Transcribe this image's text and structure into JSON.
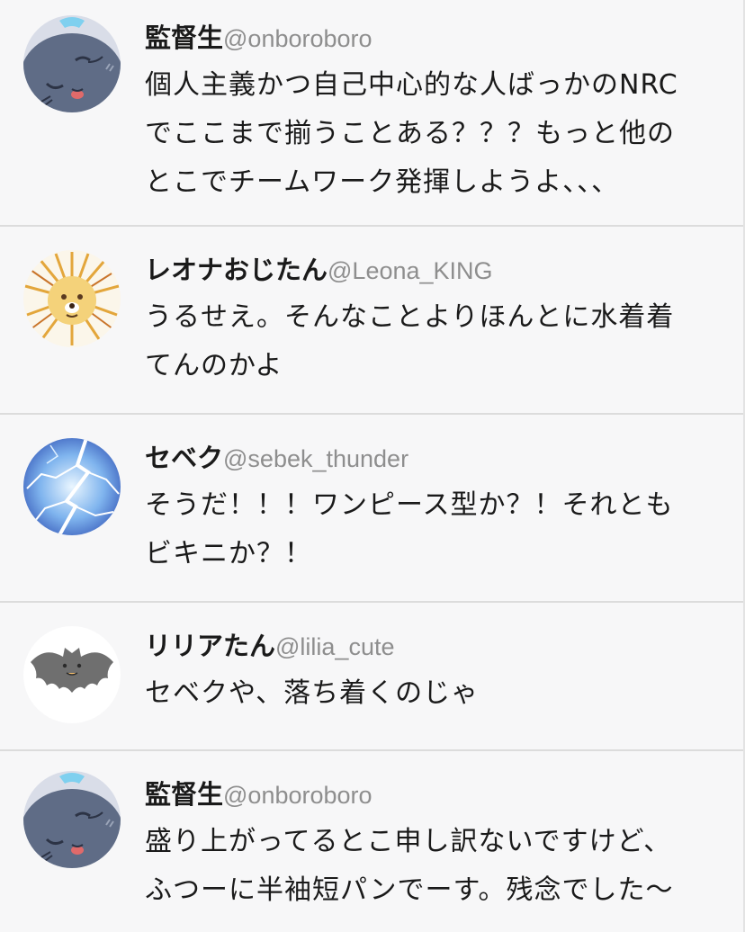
{
  "posts": [
    {
      "name": "監督生",
      "handle": "@onboroboro",
      "avatar": "gray-cat-avatar",
      "lines": [
        "個人主義かつ自己中心的な人ばっかのNRC",
        "でここまで揃うことある？？？もっと他の",
        "とこでチームワーク発揮しようよ、、、"
      ]
    },
    {
      "name": "レオナおじたん",
      "handle": "@Leona_KING",
      "avatar": "lion-avatar",
      "lines": [
        "うるせえ。そんなことよりほんとに水着着",
        "てんのかよ"
      ]
    },
    {
      "name": "セベク",
      "handle": "@sebek_thunder",
      "avatar": "lightning-avatar",
      "lines": [
        "そうだ！！！ワンピース型か？！それとも",
        "ビキニか？！"
      ]
    },
    {
      "name": "リリアたん",
      "handle": "@lilia_cute",
      "avatar": "bat-avatar",
      "lines": [
        "セベクや、落ち着くのじゃ"
      ]
    },
    {
      "name": "監督生",
      "handle": "@onboroboro",
      "avatar": "gray-cat-avatar",
      "lines": [
        "盛り上がってるとこ申し訳ないですけど、",
        "ふつーに半袖短パンでーす。残念でした〜"
      ]
    }
  ],
  "colors": {
    "background": "#f7f7f8",
    "divider": "#dcdcdc",
    "name": "#1a1a1a",
    "handle": "#8e8e8e"
  }
}
